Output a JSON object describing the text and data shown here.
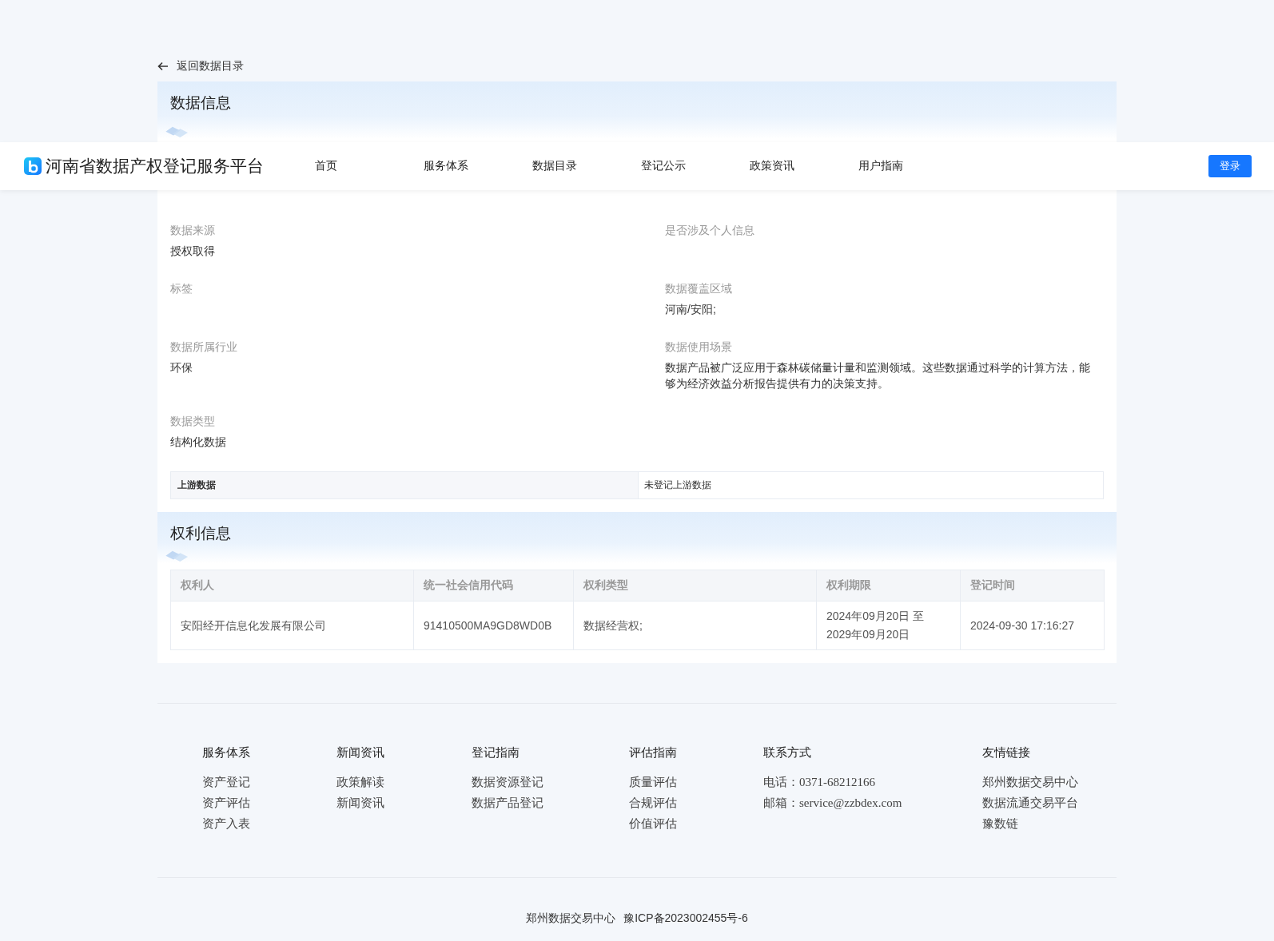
{
  "back_link": "返回数据目录",
  "header": {
    "logo_text": "河南省数据产权登记服务平台",
    "nav": [
      "首页",
      "服务体系",
      "数据目录",
      "登记公示",
      "政策资讯",
      "用户指南"
    ],
    "login_button": "登录"
  },
  "data_info": {
    "title": "数据信息",
    "fields": [
      {
        "label": "数据来源",
        "value": "授权取得"
      },
      {
        "label": "是否涉及个人信息"
      },
      {
        "label": "标签"
      },
      {
        "label": "数据覆盖区域",
        "value": "河南/安阳;"
      },
      {
        "label": "数据所属行业",
        "value": "环保"
      },
      {
        "label": "数据使用场景",
        "value": "数据产品被广泛应用于森林碳储量计量和监测领域。这些数据通过科学的计算方法，能够为经济效益分析报告提供有力的决策支持。"
      },
      {
        "label": "数据类型",
        "value": "结构化数据"
      }
    ],
    "upstream": {
      "label": "上游数据",
      "value": "未登记上游数据"
    }
  },
  "rights_info": {
    "title": "权利信息",
    "table": {
      "columns": [
        "权利人",
        "统一社会信用代码",
        "权利类型",
        "权利期限",
        "登记时间"
      ],
      "rows": [
        [
          "安阳经开信息化发展有限公司",
          "91410500MA9GD8WD0B",
          "数据经营权;",
          "2024年09月20日 至 2029年09月20日",
          "2024-09-30 17:16:27"
        ]
      ]
    }
  },
  "footer": {
    "columns": [
      {
        "heading": "服务体系",
        "links": [
          "资产登记",
          "资产评估",
          "资产入表"
        ]
      },
      {
        "heading": "新闻资讯",
        "links": [
          "政策解读",
          "新闻资讯"
        ]
      },
      {
        "heading": "登记指南",
        "links": [
          "数据资源登记",
          "数据产品登记"
        ]
      },
      {
        "heading": "评估指南",
        "links": [
          "质量评估",
          "合规评估",
          "价值评估"
        ]
      },
      {
        "heading": "联系方式",
        "links": [
          "电话：0371-68212166",
          "邮箱：service@zzbdex.com"
        ]
      },
      {
        "heading": "友情链接",
        "links": [
          "郑州数据交易中心",
          "数据流通交易平台",
          "豫数链"
        ]
      }
    ],
    "copyright": [
      "郑州数据交易中心",
      "豫ICP备2023002455号-6"
    ]
  }
}
